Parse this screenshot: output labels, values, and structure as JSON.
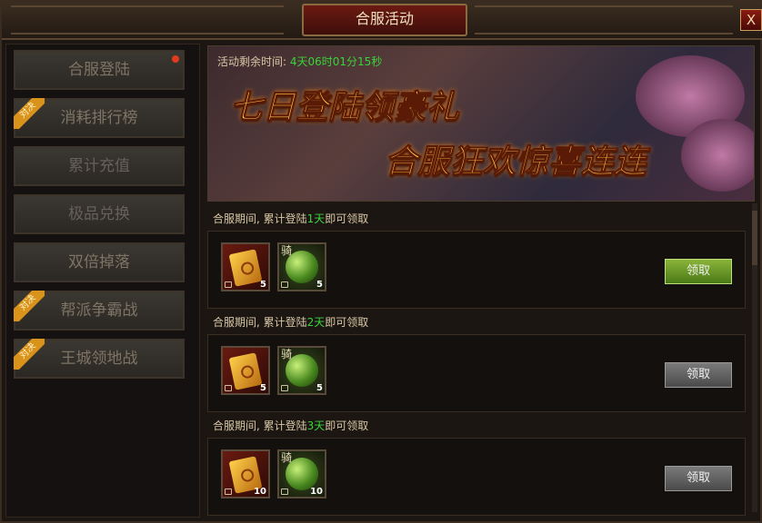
{
  "title": "合服活动",
  "close_label": "X",
  "sidebar": {
    "tabs": [
      {
        "label": "合服登陆",
        "state": "active",
        "badge": "",
        "ribbon": ""
      },
      {
        "label": "消耗排行榜",
        "state": "normal",
        "badge": "",
        "ribbon": "对决"
      },
      {
        "label": "累计充值",
        "state": "dim",
        "badge": "",
        "ribbon": ""
      },
      {
        "label": "极品兑换",
        "state": "dim",
        "badge": "",
        "ribbon": ""
      },
      {
        "label": "双倍掉落",
        "state": "normal",
        "badge": "",
        "ribbon": ""
      },
      {
        "label": "帮派争霸战",
        "state": "normal",
        "badge": "",
        "ribbon": "对决"
      },
      {
        "label": "王城领地战",
        "state": "normal",
        "badge": "",
        "ribbon": "对决"
      }
    ]
  },
  "banner": {
    "timer_label": "活动剩余时间:",
    "timer_value": "4天06时01分15秒",
    "line1": "七日登陆领豪礼",
    "line2": "合服狂欢惊喜连连"
  },
  "rewards": [
    {
      "req_prefix": "合服期间, 累计登陆",
      "req_day": "1天",
      "req_suffix": "即可领取",
      "item1_count": "5",
      "item2_count": "5",
      "item2_label": "骑",
      "button": "领取",
      "button_state": "available"
    },
    {
      "req_prefix": "合服期间, 累计登陆",
      "req_day": "2天",
      "req_suffix": "即可领取",
      "item1_count": "5",
      "item2_count": "5",
      "item2_label": "骑",
      "button": "领取",
      "button_state": "disabled"
    },
    {
      "req_prefix": "合服期间, 累计登陆",
      "req_day": "3天",
      "req_suffix": "即可领取",
      "item1_count": "10",
      "item2_count": "10",
      "item2_label": "骑",
      "button": "领取",
      "button_state": "disabled"
    }
  ],
  "colors": {
    "accent": "#d98c2a",
    "timer": "#39d33a",
    "title_bg": "#6b1a12"
  }
}
